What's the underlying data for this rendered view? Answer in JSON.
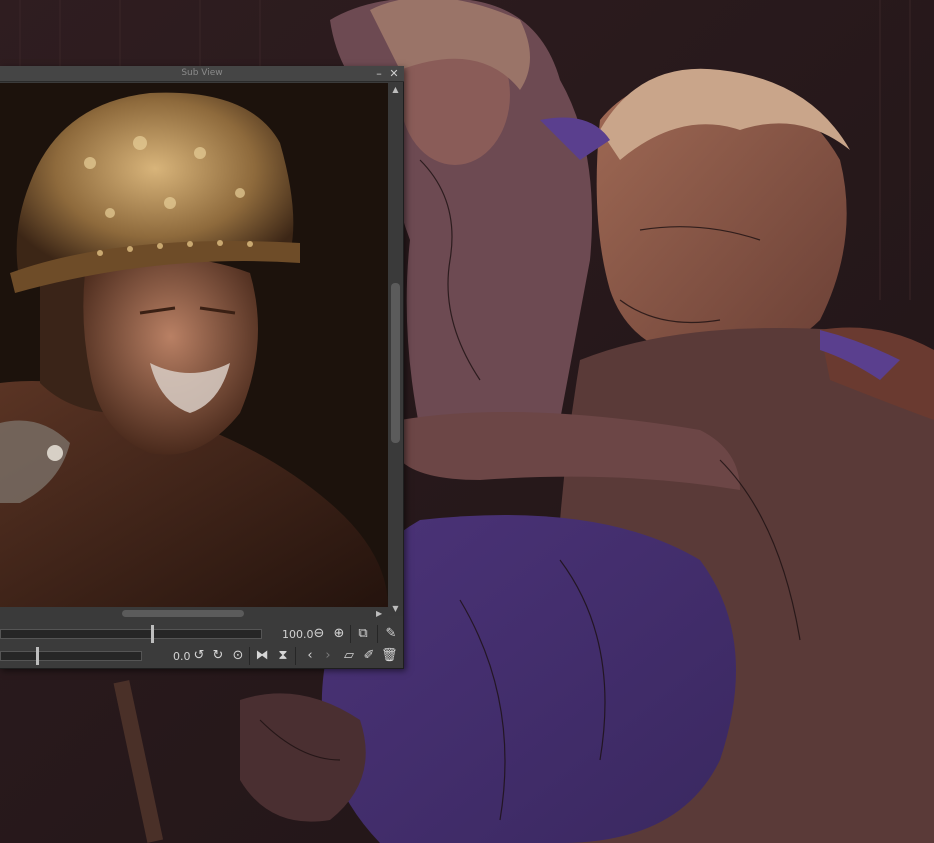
{
  "panel": {
    "title": "Sub View",
    "minimize_glyph": "–",
    "close_glyph": "✕"
  },
  "zoom": {
    "value_label": "100.0",
    "level": 0.58
  },
  "rotation": {
    "value_label": "0.0",
    "level": 0.26
  },
  "icons": {
    "zoom_out": "zoom-out-icon",
    "zoom_in": "zoom-in-icon",
    "fit_view": "fit-view-icon",
    "eyedropper": "eyedropper-icon",
    "rotate_left": "rotate-left-icon",
    "rotate_right": "rotate-right-icon",
    "reset_rotation": "reset-rotation-icon",
    "flip_horizontal": "flip-horizontal-icon",
    "flip_vertical": "flip-vertical-icon",
    "previous_image": "previous-icon",
    "next_image": "next-icon",
    "import": "folder-open-icon",
    "edit_list": "edit-list-icon",
    "delete": "trash-icon"
  },
  "colors": {
    "panel_bg": "#3b3b3b",
    "canvas_bg": "#2a1b1d",
    "violet_accent": "#5a3f8e"
  }
}
